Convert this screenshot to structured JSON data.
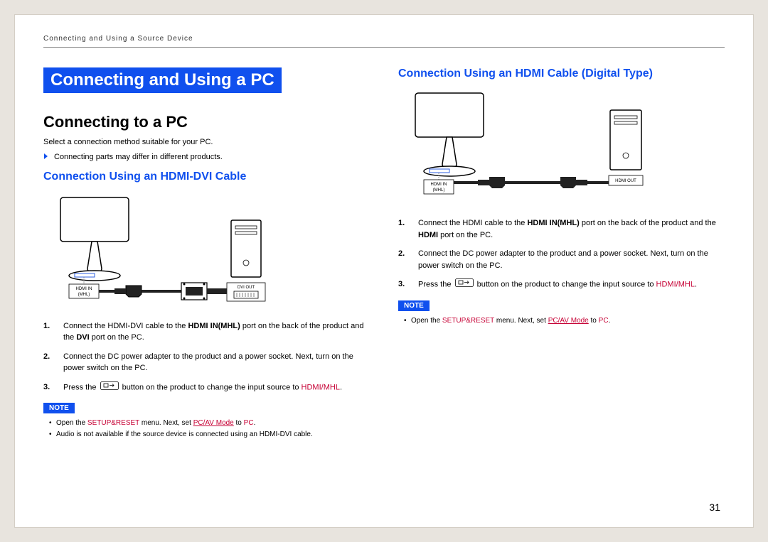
{
  "header": "Connecting and Using a Source Device",
  "pageNumber": "31",
  "left": {
    "mainTitle": "Connecting and Using a PC",
    "sectionTitle": "Connecting to a PC",
    "intro": "Select a connection method suitable for your PC.",
    "bullet1": "Connecting parts may differ in different products.",
    "subTitle": "Connection Using an HDMI-DVI Cable",
    "portLeft1": "HDMI IN",
    "portLeft2": "(MHL)",
    "portRight": "DVI OUT",
    "step1a": "Connect the HDMI-DVI cable to the ",
    "step1b": "HDMI IN(MHL)",
    "step1c": " port on the back of the product and the ",
    "step1d": "DVI",
    "step1e": " port on the PC.",
    "step2": "Connect the DC power adapter to the product and a power socket. Next, turn on the power switch on the PC.",
    "step3a": "Press the ",
    "step3b": " button on the product to change the input source to ",
    "step3c": "HDMI/MHL",
    "step3d": ".",
    "noteBadge": "NOTE",
    "note1a": "Open the ",
    "note1b": "SETUP&RESET",
    "note1c": " menu. Next, set ",
    "note1d": "PC/AV Mode",
    "note1e": " to ",
    "note1f": "PC",
    "note1g": ".",
    "note2": "Audio is not available if the source device is connected using an HDMI-DVI cable."
  },
  "right": {
    "subTitle": "Connection Using an HDMI Cable (Digital Type)",
    "portLeft1": "HDMI IN",
    "portLeft2": "(MHL)",
    "portRight": "HDMI OUT",
    "step1a": "Connect the HDMI cable to the ",
    "step1b": "HDMI IN(MHL)",
    "step1c": " port on the back of the product and the ",
    "step1d": "HDMI",
    "step1e": " port on the PC.",
    "step2": "Connect the DC power adapter to the product and a power socket. Next, turn on the power switch on the PC.",
    "step3a": "Press the ",
    "step3b": " button on the product to change the input source to ",
    "step3c": "HDMI/MHL",
    "step3d": ".",
    "noteBadge": "NOTE",
    "note1a": "Open the ",
    "note1b": "SETUP&RESET",
    "note1c": " menu. Next, set ",
    "note1d": "PC/AV Mode",
    "note1e": " to ",
    "note1f": "PC",
    "note1g": "."
  }
}
